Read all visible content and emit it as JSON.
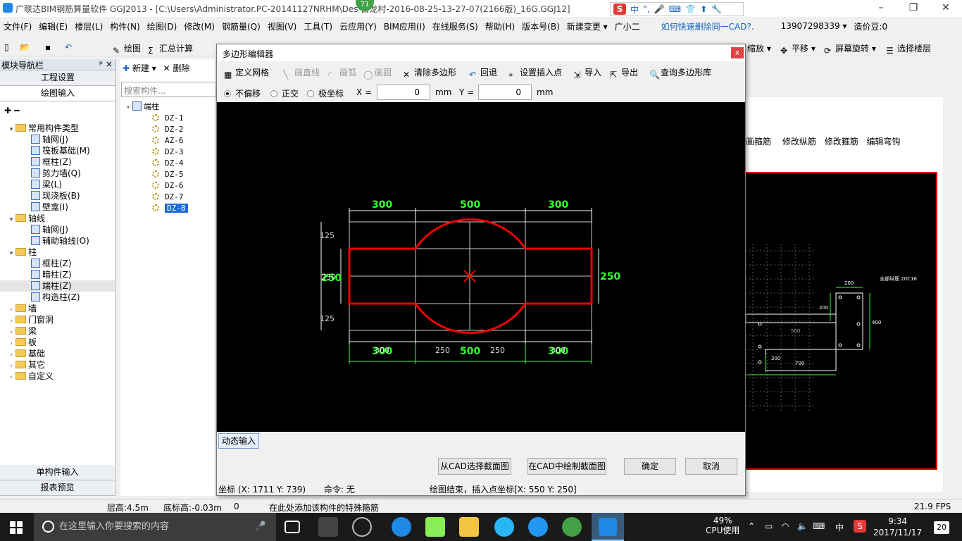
{
  "app": {
    "title": "广联达BIM钢筋算量软件 GGJ2013 - [C:\\Users\\Administrator.PC-20141127NRHM\\Des  白龙村-2016-08-25-13-27-07(2166版)_16G.GGJ12]",
    "badge": "71",
    "ime_items": [
      "中",
      "°,",
      "🎤",
      "⌨",
      "👕",
      "⬆",
      "🔧"
    ]
  },
  "menu": [
    "文件(F)",
    "编辑(E)",
    "楼层(L)",
    "构件(N)",
    "绘图(D)",
    "修改(M)",
    "钢筋量(Q)",
    "视图(V)",
    "工具(T)",
    "云应用(Y)",
    "BIM应用(I)",
    "在线服务(S)",
    "帮助(H)",
    "版本号(B)",
    "新建变更 ▾",
    "广小二",
    "如何快速删除同一CAD?.",
    "13907298339 ▾",
    "造价豆:0"
  ],
  "toolbar": {
    "draw": "绘图",
    "sum": "汇总计算",
    "zoom": "缩放 ▾",
    "pan": "平移 ▾",
    "rotate": "屏幕旋转 ▾",
    "floor": "选择楼层"
  },
  "left_panel": {
    "header": "模块导航栏",
    "pin": "ᵖ ×",
    "btn_project": "工程设置",
    "btn_draw": "绘图输入",
    "btn_single": "单构件输入",
    "btn_report": "报表预览",
    "tree": [
      {
        "label": "常用构件类型",
        "level": 0,
        "type": "folder",
        "open": true
      },
      {
        "label": "轴网(J)",
        "level": 1
      },
      {
        "label": "筏板基础(M)",
        "level": 1
      },
      {
        "label": "框柱(Z)",
        "level": 1
      },
      {
        "label": "剪力墙(Q)",
        "level": 1
      },
      {
        "label": "梁(L)",
        "level": 1
      },
      {
        "label": "现浇板(B)",
        "level": 1
      },
      {
        "label": "壁龛(I)",
        "level": 1
      },
      {
        "label": "轴线",
        "level": 0,
        "type": "folder",
        "open": true
      },
      {
        "label": "轴网(J)",
        "level": 1
      },
      {
        "label": "辅助轴线(O)",
        "level": 1
      },
      {
        "label": "柱",
        "level": 0,
        "type": "folder",
        "open": true
      },
      {
        "label": "框柱(Z)",
        "level": 1
      },
      {
        "label": "暗柱(Z)",
        "level": 1
      },
      {
        "label": "端柱(Z)",
        "level": 1,
        "selected": true
      },
      {
        "label": "构造柱(Z)",
        "level": 1
      },
      {
        "label": "墙",
        "level": 0,
        "type": "folder"
      },
      {
        "label": "门窗洞",
        "level": 0,
        "type": "folder"
      },
      {
        "label": "梁",
        "level": 0,
        "type": "folder"
      },
      {
        "label": "板",
        "level": 0,
        "type": "folder"
      },
      {
        "label": "基础",
        "level": 0,
        "type": "folder"
      },
      {
        "label": "其它",
        "level": 0,
        "type": "folder"
      },
      {
        "label": "自定义",
        "level": 0,
        "type": "folder"
      }
    ]
  },
  "component_panel": {
    "new": "新建 ▾",
    "delete": "删除",
    "search_placeholder": "搜索构件...",
    "root": "端柱",
    "items": [
      "DZ-1",
      "DZ-2",
      "AZ-6",
      "DZ-3",
      "DZ-4",
      "DZ-5",
      "DZ-6",
      "DZ-7",
      "DZ-8"
    ],
    "selected": "DZ-8"
  },
  "dialog": {
    "title": "多边形编辑器",
    "close": "x",
    "tools": {
      "grid": "定义网格",
      "line": "画直线",
      "arc": "画弧",
      "circle": "画圆",
      "clear": "清除多边形",
      "undo": "回退",
      "insert": "设置插入点",
      "import": "导入",
      "export": "导出",
      "query": "查询多边形库"
    },
    "modes": [
      "不偏移",
      "正交",
      "极坐标"
    ],
    "x_label": "X =",
    "x_value": "0",
    "y_label": "Y =",
    "y_value": "0",
    "unit": "mm",
    "dims_top": [
      "300",
      "500",
      "300"
    ],
    "dims_bottom_green": [
      "300",
      "500",
      "300"
    ],
    "dims_bottom_white": [
      "300",
      "250",
      "250",
      "300"
    ],
    "dims_left": [
      "125",
      "250",
      "125"
    ],
    "dim_right": "250",
    "left_mid_green": "250",
    "dyn_input": "动态输入",
    "btn_cad_select": "从CAD选择截面图",
    "btn_cad_draw": "在CAD中绘制截面图",
    "btn_ok": "确定",
    "btn_cancel": "取消",
    "status_coord": "坐标 (X: 1711 Y: 739)",
    "status_cmd": "命令: 无",
    "status_msg": "绘图结束，插入点坐标[X: 550 Y: 250]"
  },
  "right_panel": {
    "tabs": [
      "画箍筋",
      "修改纵筋",
      "修改箍筋",
      "编辑弯钩"
    ],
    "labels": {
      "top": "200",
      "side": "200",
      "right": "400",
      "main": "全部纵筋 20C16",
      "dim500": "500",
      "dim700": "700",
      "dim300": "300"
    }
  },
  "statusbar": {
    "floor_height": "层高:4.5m",
    "base_height": "底标高:-0.03m",
    "zero": "0",
    "hint": "在此处添加该构件的特殊箍筋",
    "fps": "21.9 FPS"
  },
  "taskbar": {
    "search_placeholder": "在这里输入你要搜索的内容",
    "cpu_pct": "49%",
    "cpu_label": "CPU使用",
    "ime": "中",
    "time": "9:34",
    "date": "2017/11/17",
    "notif": "20"
  }
}
